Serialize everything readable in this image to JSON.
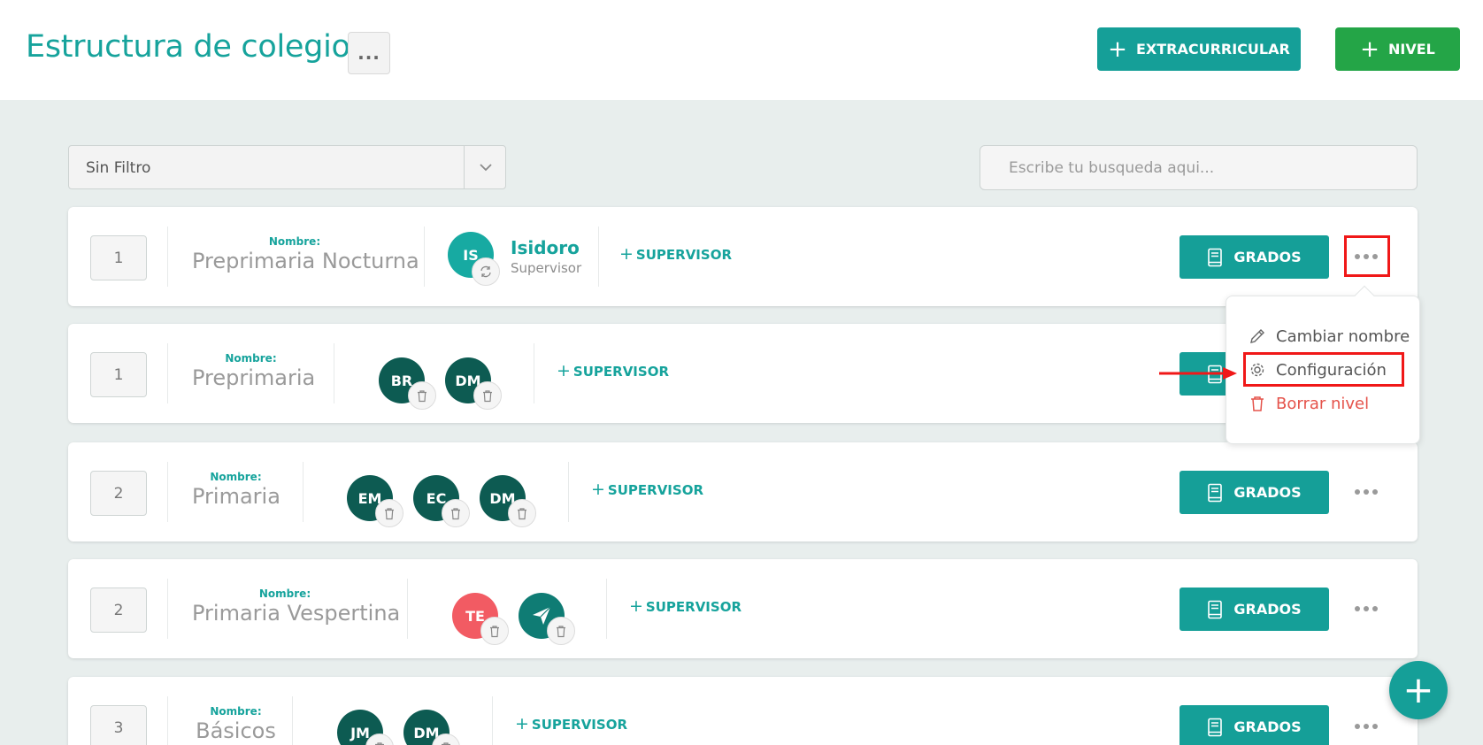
{
  "header": {
    "title": "Estructura de colegio",
    "more_label": "...",
    "extracurricular_label": "EXTRACURRICULAR",
    "nivel_label": "NIVEL",
    "plus": "+"
  },
  "filters": {
    "filter_value": "Sin Filtro",
    "search_placeholder": "Escribe tu busqueda aqui..."
  },
  "common": {
    "name_label": "Nombre:",
    "add_supervisor_label": "SUPERVISOR",
    "plus": "+",
    "grados_label": "GRADOS"
  },
  "levels": [
    {
      "order": "1",
      "name": "Preprimaria Nocturna",
      "supervisors": [
        {
          "initials": "IS",
          "name": "Isidoro",
          "role": "Supervisor"
        }
      ]
    },
    {
      "order": "1",
      "name": "Preprimaria",
      "supervisors": [
        {
          "initials": "BR"
        },
        {
          "initials": "DM"
        }
      ]
    },
    {
      "order": "2",
      "name": "Primaria",
      "supervisors": [
        {
          "initials": "EM"
        },
        {
          "initials": "EC"
        },
        {
          "initials": "DM"
        }
      ]
    },
    {
      "order": "2",
      "name": "Primaria Vespertina",
      "supervisors": [
        {
          "initials": "TE"
        },
        {
          "initials": ""
        }
      ]
    },
    {
      "order": "3",
      "name": "Básicos",
      "supervisors": [
        {
          "initials": "JM"
        },
        {
          "initials": "DM"
        }
      ]
    }
  ],
  "context_menu": {
    "rename": "Cambiar nombre",
    "config": "Configuración",
    "delete": "Borrar nivel"
  },
  "fab_label": "+",
  "colors": {
    "accent": "#159f98",
    "green": "#24a547",
    "danger": "#e5534b",
    "highlight": "#f01818",
    "avatar_dark": "#0d5b52"
  }
}
